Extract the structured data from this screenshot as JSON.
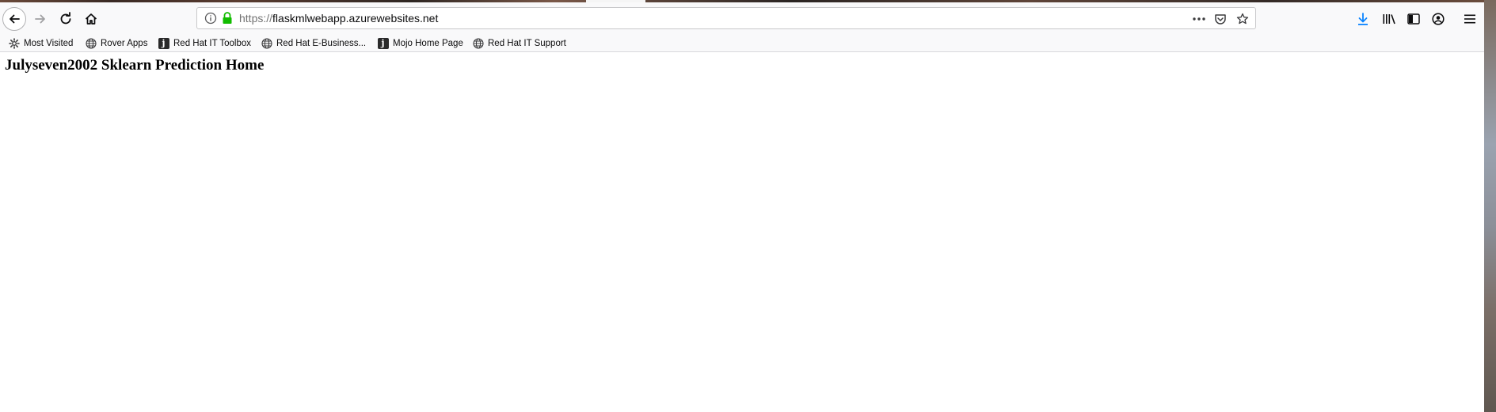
{
  "browser": {
    "url_scheme": "https://",
    "url_host": "flaskmlwebapp.azurewebsites.net",
    "colors": {
      "accent_download": "#0a84ff",
      "lock_green": "#12bc00"
    },
    "icons": [
      "back-icon",
      "forward-icon",
      "reload-icon",
      "home-icon",
      "info-icon",
      "lock-icon",
      "more-icon",
      "pocket-icon",
      "star-icon",
      "download-icon",
      "library-icon",
      "sidebar-icon",
      "account-icon",
      "menu-icon"
    ]
  },
  "bookmarks": [
    {
      "label": "Most Visited",
      "icon": "gear-icon"
    },
    {
      "label": "Rover Apps",
      "icon": "globe-icon"
    },
    {
      "label": "Red Hat IT Toolbox",
      "icon": "j-icon"
    },
    {
      "label": "Red Hat E-Business...",
      "icon": "globe-icon"
    },
    {
      "label": "Mojo Home Page",
      "icon": "j-icon"
    },
    {
      "label": "Red Hat IT Support",
      "icon": "globe-icon"
    }
  ],
  "page": {
    "heading": "Julyseven2002 Sklearn Prediction Home"
  }
}
